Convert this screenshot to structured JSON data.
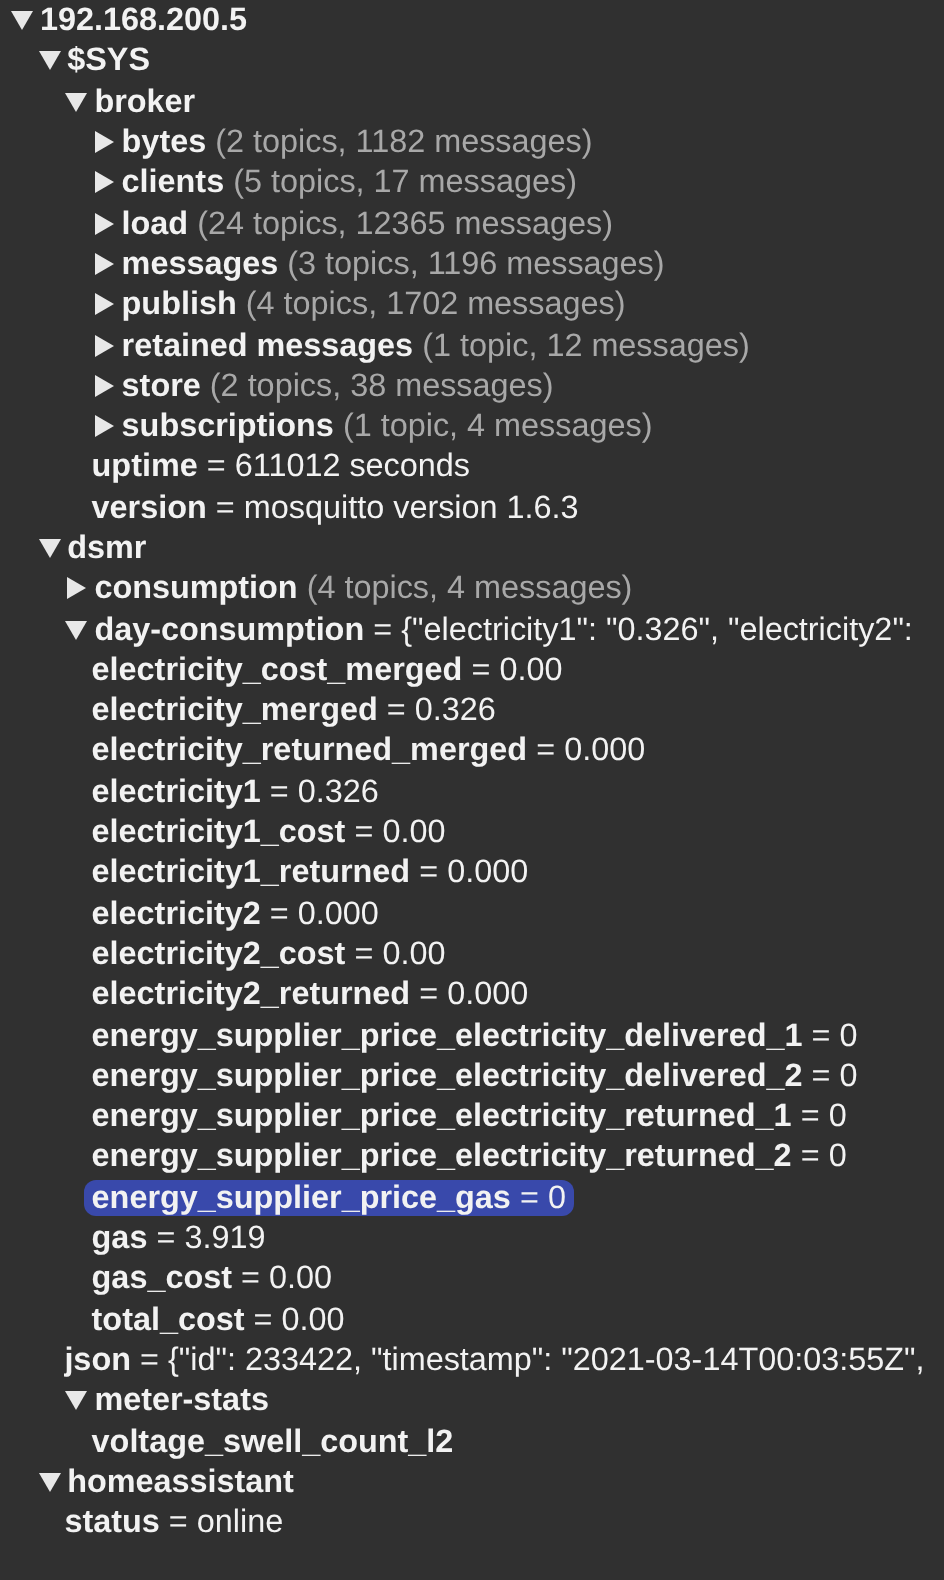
{
  "tree": [
    {
      "kind": "branch",
      "name": "192.168.200.5",
      "expanded": true,
      "selected": false,
      "children": [
        {
          "kind": "branch",
          "name": "$SYS",
          "expanded": true,
          "selected": false,
          "children": [
            {
              "kind": "branch",
              "name": "broker",
              "expanded": true,
              "selected": false,
              "children": [
                {
                  "kind": "branch",
                  "name": "bytes",
                  "summary": "(2 topics, 1182 messages)",
                  "expanded": false,
                  "selected": false
                },
                {
                  "kind": "branch",
                  "name": "clients",
                  "summary": "(5 topics, 17 messages)",
                  "expanded": false,
                  "selected": false
                },
                {
                  "kind": "branch",
                  "name": "load",
                  "summary": "(24 topics, 12365 messages)",
                  "expanded": false,
                  "selected": false
                },
                {
                  "kind": "branch",
                  "name": "messages",
                  "summary": "(3 topics, 1196 messages)",
                  "expanded": false,
                  "selected": false
                },
                {
                  "kind": "branch",
                  "name": "publish",
                  "summary": "(4 topics, 1702 messages)",
                  "expanded": false,
                  "selected": false
                },
                {
                  "kind": "branch",
                  "name": "retained messages",
                  "summary": "(1 topic, 12 messages)",
                  "expanded": false,
                  "selected": false
                },
                {
                  "kind": "branch",
                  "name": "store",
                  "summary": "(2 topics, 38 messages)",
                  "expanded": false,
                  "selected": false
                },
                {
                  "kind": "branch",
                  "name": "subscriptions",
                  "summary": "(1 topic, 4 messages)",
                  "expanded": false,
                  "selected": false
                },
                {
                  "kind": "leaf",
                  "name": "uptime",
                  "sep": "=",
                  "value": "611012 seconds",
                  "selected": false
                },
                {
                  "kind": "leaf",
                  "name": "version",
                  "sep": "=",
                  "value": "mosquitto version 1.6.3",
                  "selected": false
                }
              ]
            }
          ]
        },
        {
          "kind": "branch",
          "name": "dsmr",
          "expanded": true,
          "selected": false,
          "children": [
            {
              "kind": "branch",
              "name": "consumption",
              "summary": "(4 topics, 4 messages)",
              "expanded": false,
              "selected": false
            },
            {
              "kind": "branch",
              "name": "day-consumption",
              "sep": "=",
              "value": "{\"electricity1\": \"0.326\", \"electricity2\":",
              "expanded": true,
              "selected": false,
              "children": [
                {
                  "kind": "leaf",
                  "name": "electricity_cost_merged",
                  "sep": "=",
                  "value": "0.00",
                  "selected": false
                },
                {
                  "kind": "leaf",
                  "name": "electricity_merged",
                  "sep": "=",
                  "value": "0.326",
                  "selected": false
                },
                {
                  "kind": "leaf",
                  "name": "electricity_returned_merged",
                  "sep": "=",
                  "value": "0.000",
                  "selected": false
                },
                {
                  "kind": "leaf",
                  "name": "electricity1",
                  "sep": "=",
                  "value": "0.326",
                  "selected": false
                },
                {
                  "kind": "leaf",
                  "name": "electricity1_cost",
                  "sep": "=",
                  "value": "0.00",
                  "selected": false
                },
                {
                  "kind": "leaf",
                  "name": "electricity1_returned",
                  "sep": "=",
                  "value": "0.000",
                  "selected": false
                },
                {
                  "kind": "leaf",
                  "name": "electricity2",
                  "sep": "=",
                  "value": "0.000",
                  "selected": false
                },
                {
                  "kind": "leaf",
                  "name": "electricity2_cost",
                  "sep": "=",
                  "value": "0.00",
                  "selected": false
                },
                {
                  "kind": "leaf",
                  "name": "electricity2_returned",
                  "sep": "=",
                  "value": "0.000",
                  "selected": false
                },
                {
                  "kind": "leaf",
                  "name": "energy_supplier_price_electricity_delivered_1",
                  "sep": "=",
                  "value": "0",
                  "selected": false
                },
                {
                  "kind": "leaf",
                  "name": "energy_supplier_price_electricity_delivered_2",
                  "sep": "=",
                  "value": "0",
                  "selected": false
                },
                {
                  "kind": "leaf",
                  "name": "energy_supplier_price_electricity_returned_1",
                  "sep": "=",
                  "value": "0",
                  "selected": false
                },
                {
                  "kind": "leaf",
                  "name": "energy_supplier_price_electricity_returned_2",
                  "sep": "=",
                  "value": "0",
                  "selected": false
                },
                {
                  "kind": "leaf",
                  "name": "energy_supplier_price_gas",
                  "sep": "=",
                  "value": "0",
                  "selected": true
                },
                {
                  "kind": "leaf",
                  "name": "gas",
                  "sep": "=",
                  "value": "3.919",
                  "selected": false
                },
                {
                  "kind": "leaf",
                  "name": "gas_cost",
                  "sep": "=",
                  "value": "0.00",
                  "selected": false
                },
                {
                  "kind": "leaf",
                  "name": "total_cost",
                  "sep": "=",
                  "value": "0.00",
                  "selected": false
                }
              ]
            },
            {
              "kind": "leaf",
              "name": "json",
              "sep": "=",
              "value": "{\"id\": 233422, \"timestamp\": \"2021-03-14T00:03:55Z\",",
              "selected": false
            },
            {
              "kind": "branch",
              "name": "meter-stats",
              "expanded": true,
              "selected": false,
              "children": [
                {
                  "kind": "leaf",
                  "name": "voltage_swell_count_l2",
                  "selected": false
                }
              ]
            }
          ]
        },
        {
          "kind": "branch",
          "name": "homeassistant",
          "expanded": true,
          "selected": false,
          "children": [
            {
              "kind": "leaf",
              "name": "status",
              "sep": "=",
              "value": "online",
              "selected": false
            }
          ]
        }
      ]
    }
  ]
}
